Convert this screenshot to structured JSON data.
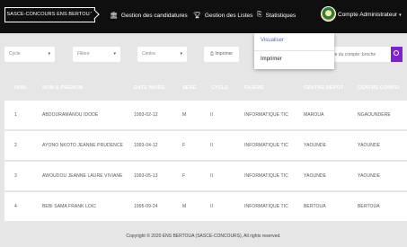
{
  "header": {
    "brand": "SASCE-CONCOURS ENS BERTOUA",
    "nav": {
      "candidatures": "Gestion des candidatures",
      "listes": "Gestion des Listes",
      "statistiques": "Statistiques",
      "account": "Compte Administrateur"
    },
    "icons": {
      "candidatures": "bank-icon",
      "listes": "trophy-icon",
      "statistiques": "copy-icon"
    }
  },
  "dropdown": {
    "items": [
      "Visualiser",
      "Imprimer"
    ]
  },
  "filters": {
    "cycle": "Cycle",
    "filiere": "Filière",
    "centre": "Centre",
    "print_button": "Imprimer",
    "search_placeholder": "entre du compte: broche"
  },
  "table": {
    "headers": [
      "NUM.",
      "NOM & PRENOM",
      "DATE NAISS.",
      "SEXE",
      "CYCLE",
      "FILIERE",
      "CENTRE DEPOT",
      "CENTRE COMPO"
    ],
    "rows": [
      [
        "1",
        "ABDOURAMANOU IDODE",
        "1993-02-12",
        "M",
        "II",
        "INFORMATIQUE TIC",
        "MAROUA",
        "NGAOUNDERE"
      ],
      [
        "2",
        "AYONO NKOTO JEANNE PRUDENCE",
        "1993-04-12",
        "F",
        "II",
        "INFORMATIQUE TIC",
        "YAOUNDE",
        "YAOUNDE"
      ],
      [
        "3",
        "AWOUDOU JEANNE LAURE VIVIANE",
        "1993-05-13",
        "F",
        "II",
        "INFORMATIQUE TIC",
        "YAOUNDE",
        "YAOUNDE"
      ],
      [
        "4",
        "BEBI SAMA FRANK LOIC",
        "1995-09-24",
        "M",
        "II",
        "INFORMATIQUE TIC",
        "BERTOUA",
        "BERTOUA"
      ]
    ]
  },
  "footer": "Copyright © 2020 ENS BERTOUA (SASCE-CONCOURS), All rights reserved.",
  "colors": {
    "topbar": "#0f0f0f",
    "background": "#e6e6e6",
    "accent": "#7e22ce",
    "link": "#4a6fbf"
  }
}
